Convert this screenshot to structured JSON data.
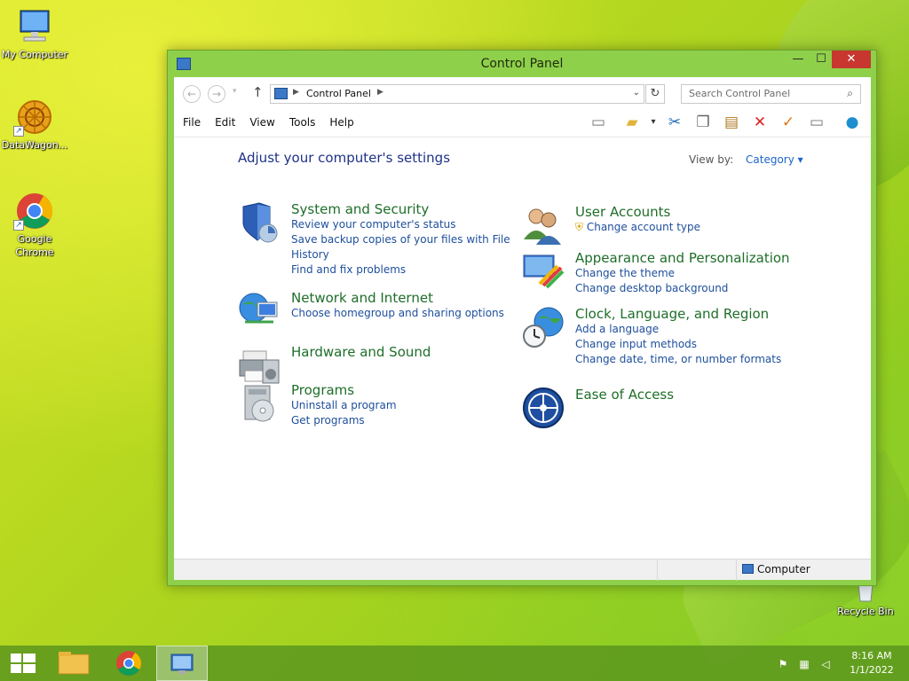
{
  "desktop": {
    "icons": [
      {
        "label": "My Computer"
      },
      {
        "label": "DataWagon..."
      },
      {
        "label": "Google Chrome"
      },
      {
        "label": "Recycle Bin"
      }
    ]
  },
  "window": {
    "title": "Control Panel",
    "controls": {
      "minimize": "—",
      "maximize": "☐",
      "close": "✕"
    }
  },
  "address_bar": {
    "breadcrumb": "Control Panel",
    "search_placeholder": "Search Control Panel"
  },
  "menu": {
    "items": [
      "File",
      "Edit",
      "View",
      "Tools",
      "Help"
    ]
  },
  "toolbar": {
    "icons": [
      "layout-icon",
      "folder-icon",
      "cut-icon",
      "copy-icon",
      "paste-icon",
      "delete-icon",
      "check-icon",
      "properties-icon",
      "web-icon"
    ]
  },
  "content": {
    "heading": "Adjust your computer's settings",
    "view_by_label": "View by:",
    "view_by_value": "Category",
    "categories_left": [
      {
        "title": "System and Security",
        "links": [
          "Review your computer's status",
          "Save backup copies of your files with File",
          "History",
          "Find and fix problems"
        ]
      },
      {
        "title": "Network and Internet",
        "links": [
          "Choose homegroup and sharing options"
        ]
      },
      {
        "title": "Hardware and Sound",
        "links": []
      },
      {
        "title": "Programs",
        "links": [
          "Uninstall a program",
          "Get programs"
        ]
      }
    ],
    "categories_right": [
      {
        "title": "User Accounts",
        "links": [
          "Change account type"
        ]
      },
      {
        "title": "Appearance and Personalization",
        "links": [
          "Change the theme",
          "Change desktop background"
        ]
      },
      {
        "title": "Clock, Language, and Region",
        "links": [
          "Add a language",
          "Change input methods",
          "Change date, time, or number formats"
        ]
      },
      {
        "title": "Ease of Access",
        "links": []
      }
    ]
  },
  "status_bar": {
    "location": "Computer"
  },
  "taskbar": {
    "clock_time": "8:16 AM",
    "clock_date": "1/1/2022"
  }
}
